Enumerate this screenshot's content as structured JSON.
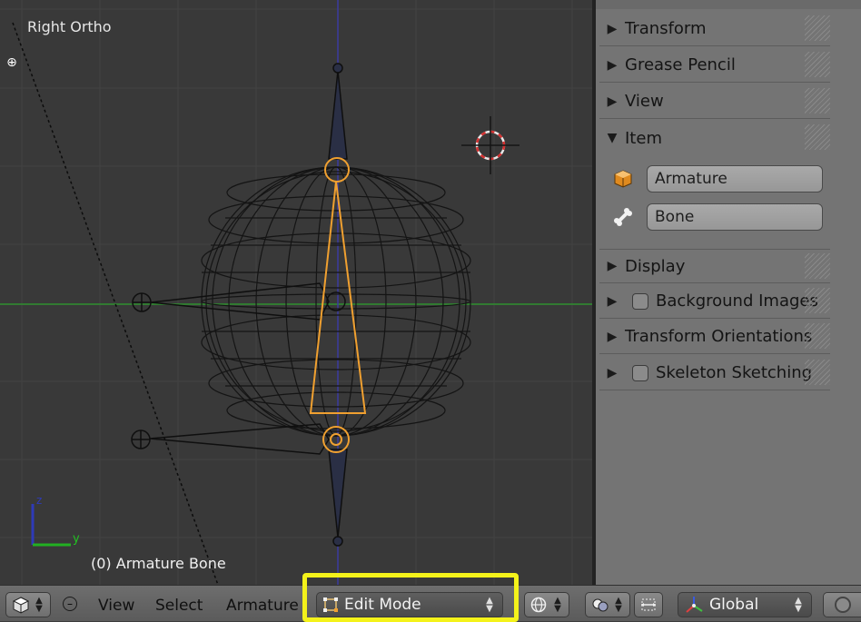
{
  "viewport": {
    "view_label": "Right Ortho",
    "status_text": "(0) Armature Bone",
    "axis_y_label": "y",
    "axis_z_label": "z",
    "colors": {
      "background": "#393939",
      "grid": "#434343",
      "x_axis": "#2f8f2f",
      "selected_bone": "#f0a030",
      "wire": "#0f0f0f",
      "bone_fill": "#2a2f45",
      "cursor": "#d43030"
    }
  },
  "properties_panel": {
    "sections": [
      {
        "label": "Transform",
        "expanded": false,
        "has_checkbox": false
      },
      {
        "label": "Grease Pencil",
        "expanded": false,
        "has_checkbox": false
      },
      {
        "label": "View",
        "expanded": false,
        "has_checkbox": false
      },
      {
        "label": "Item",
        "expanded": true,
        "has_checkbox": false
      },
      {
        "label": "Display",
        "expanded": false,
        "has_checkbox": false
      },
      {
        "label": "Background Images",
        "expanded": false,
        "has_checkbox": true
      },
      {
        "label": "Transform Orientations",
        "expanded": false,
        "has_checkbox": false
      },
      {
        "label": "Skeleton Sketching",
        "expanded": false,
        "has_checkbox": true
      }
    ],
    "item": {
      "object_name": "Armature",
      "object_icon": "armature-object-icon",
      "bone_name": "Bone",
      "bone_icon": "bone-icon"
    }
  },
  "header": {
    "editor_type_icon": "3d-view-icon",
    "menus": [
      "View",
      "Select",
      "Armature"
    ],
    "mode": "Edit Mode",
    "mode_icon": "edit-mode-icon",
    "transform_orientation": "Global",
    "highlight_color": "#f4f21a"
  }
}
